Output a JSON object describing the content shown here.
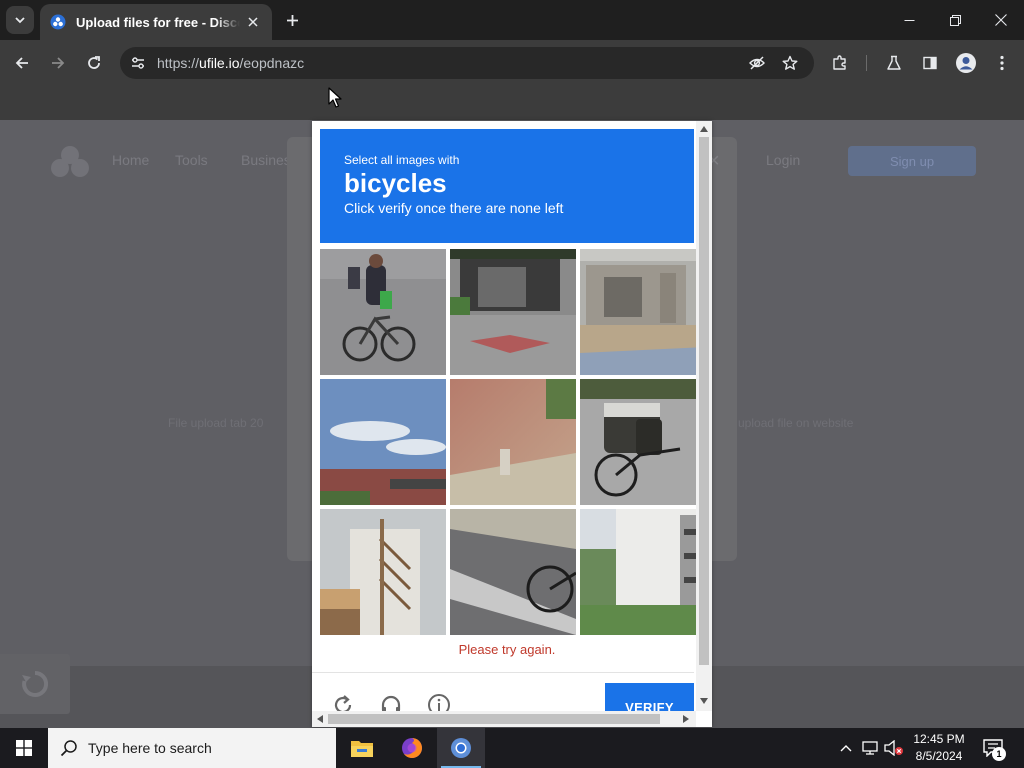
{
  "browser": {
    "tab_title": "Upload files for free - DiscordCDN",
    "url_prefix": "https://",
    "url_host": "ufile.io",
    "url_path": "/eopdnazc"
  },
  "page_background": {
    "nav_items": [
      "Home",
      "Tools",
      "Business"
    ],
    "nav_right_link": "Login",
    "nav_button": "Sign up",
    "left_text": "File upload tab 20",
    "right_text": "upload file on website"
  },
  "captcha": {
    "prompt": "Select all images with",
    "target": "bicycles",
    "instruction": "Click verify once there are none left",
    "error": "Please try again.",
    "verify_label": "VERIFY",
    "tiles": [
      {
        "row": 1,
        "col": 1,
        "subject": "person riding bicycle"
      },
      {
        "row": 1,
        "col": 2,
        "subject": "shop front"
      },
      {
        "row": 1,
        "col": 3,
        "subject": "bus shelter"
      },
      {
        "row": 2,
        "col": 1,
        "subject": "sky and building"
      },
      {
        "row": 2,
        "col": 2,
        "subject": "blurry ground"
      },
      {
        "row": 2,
        "col": 3,
        "subject": "bicycle with panniers"
      },
      {
        "row": 3,
        "col": 1,
        "subject": "building with stairs"
      },
      {
        "row": 3,
        "col": 2,
        "subject": "bicycle wheel on road"
      },
      {
        "row": 3,
        "col": 3,
        "subject": "apartment building"
      }
    ]
  },
  "taskbar": {
    "search_placeholder": "Type here to search",
    "time": "12:45 PM",
    "date": "8/5/2024",
    "notification_count": "1"
  },
  "colors": {
    "accent": "#1a73e8",
    "error": "#c0392b",
    "chrome_dark": "#3c3c3c"
  }
}
